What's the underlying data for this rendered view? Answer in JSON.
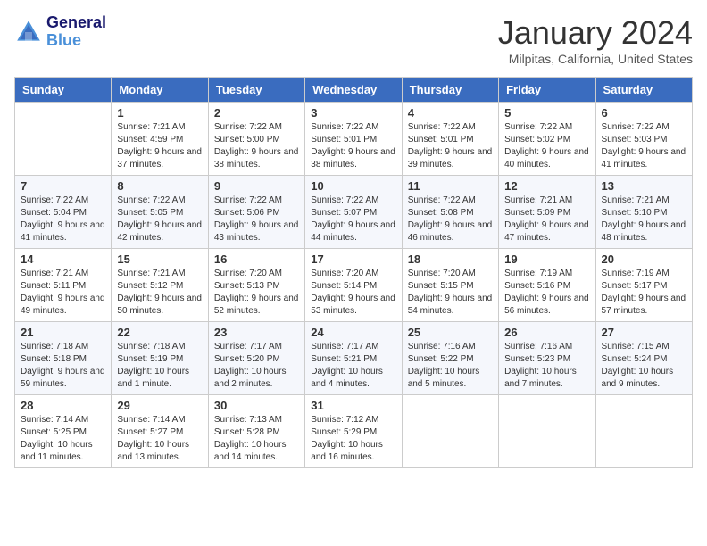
{
  "header": {
    "logo_line1": "General",
    "logo_line2": "Blue",
    "month_title": "January 2024",
    "location": "Milpitas, California, United States"
  },
  "weekdays": [
    "Sunday",
    "Monday",
    "Tuesday",
    "Wednesday",
    "Thursday",
    "Friday",
    "Saturday"
  ],
  "weeks": [
    [
      {
        "day": "",
        "sunrise": "",
        "sunset": "",
        "daylight": ""
      },
      {
        "day": "1",
        "sunrise": "Sunrise: 7:21 AM",
        "sunset": "Sunset: 4:59 PM",
        "daylight": "Daylight: 9 hours and 37 minutes."
      },
      {
        "day": "2",
        "sunrise": "Sunrise: 7:22 AM",
        "sunset": "Sunset: 5:00 PM",
        "daylight": "Daylight: 9 hours and 38 minutes."
      },
      {
        "day": "3",
        "sunrise": "Sunrise: 7:22 AM",
        "sunset": "Sunset: 5:01 PM",
        "daylight": "Daylight: 9 hours and 38 minutes."
      },
      {
        "day": "4",
        "sunrise": "Sunrise: 7:22 AM",
        "sunset": "Sunset: 5:01 PM",
        "daylight": "Daylight: 9 hours and 39 minutes."
      },
      {
        "day": "5",
        "sunrise": "Sunrise: 7:22 AM",
        "sunset": "Sunset: 5:02 PM",
        "daylight": "Daylight: 9 hours and 40 minutes."
      },
      {
        "day": "6",
        "sunrise": "Sunrise: 7:22 AM",
        "sunset": "Sunset: 5:03 PM",
        "daylight": "Daylight: 9 hours and 41 minutes."
      }
    ],
    [
      {
        "day": "7",
        "sunrise": "Sunrise: 7:22 AM",
        "sunset": "Sunset: 5:04 PM",
        "daylight": "Daylight: 9 hours and 41 minutes."
      },
      {
        "day": "8",
        "sunrise": "Sunrise: 7:22 AM",
        "sunset": "Sunset: 5:05 PM",
        "daylight": "Daylight: 9 hours and 42 minutes."
      },
      {
        "day": "9",
        "sunrise": "Sunrise: 7:22 AM",
        "sunset": "Sunset: 5:06 PM",
        "daylight": "Daylight: 9 hours and 43 minutes."
      },
      {
        "day": "10",
        "sunrise": "Sunrise: 7:22 AM",
        "sunset": "Sunset: 5:07 PM",
        "daylight": "Daylight: 9 hours and 44 minutes."
      },
      {
        "day": "11",
        "sunrise": "Sunrise: 7:22 AM",
        "sunset": "Sunset: 5:08 PM",
        "daylight": "Daylight: 9 hours and 46 minutes."
      },
      {
        "day": "12",
        "sunrise": "Sunrise: 7:21 AM",
        "sunset": "Sunset: 5:09 PM",
        "daylight": "Daylight: 9 hours and 47 minutes."
      },
      {
        "day": "13",
        "sunrise": "Sunrise: 7:21 AM",
        "sunset": "Sunset: 5:10 PM",
        "daylight": "Daylight: 9 hours and 48 minutes."
      }
    ],
    [
      {
        "day": "14",
        "sunrise": "Sunrise: 7:21 AM",
        "sunset": "Sunset: 5:11 PM",
        "daylight": "Daylight: 9 hours and 49 minutes."
      },
      {
        "day": "15",
        "sunrise": "Sunrise: 7:21 AM",
        "sunset": "Sunset: 5:12 PM",
        "daylight": "Daylight: 9 hours and 50 minutes."
      },
      {
        "day": "16",
        "sunrise": "Sunrise: 7:20 AM",
        "sunset": "Sunset: 5:13 PM",
        "daylight": "Daylight: 9 hours and 52 minutes."
      },
      {
        "day": "17",
        "sunrise": "Sunrise: 7:20 AM",
        "sunset": "Sunset: 5:14 PM",
        "daylight": "Daylight: 9 hours and 53 minutes."
      },
      {
        "day": "18",
        "sunrise": "Sunrise: 7:20 AM",
        "sunset": "Sunset: 5:15 PM",
        "daylight": "Daylight: 9 hours and 54 minutes."
      },
      {
        "day": "19",
        "sunrise": "Sunrise: 7:19 AM",
        "sunset": "Sunset: 5:16 PM",
        "daylight": "Daylight: 9 hours and 56 minutes."
      },
      {
        "day": "20",
        "sunrise": "Sunrise: 7:19 AM",
        "sunset": "Sunset: 5:17 PM",
        "daylight": "Daylight: 9 hours and 57 minutes."
      }
    ],
    [
      {
        "day": "21",
        "sunrise": "Sunrise: 7:18 AM",
        "sunset": "Sunset: 5:18 PM",
        "daylight": "Daylight: 9 hours and 59 minutes."
      },
      {
        "day": "22",
        "sunrise": "Sunrise: 7:18 AM",
        "sunset": "Sunset: 5:19 PM",
        "daylight": "Daylight: 10 hours and 1 minute."
      },
      {
        "day": "23",
        "sunrise": "Sunrise: 7:17 AM",
        "sunset": "Sunset: 5:20 PM",
        "daylight": "Daylight: 10 hours and 2 minutes."
      },
      {
        "day": "24",
        "sunrise": "Sunrise: 7:17 AM",
        "sunset": "Sunset: 5:21 PM",
        "daylight": "Daylight: 10 hours and 4 minutes."
      },
      {
        "day": "25",
        "sunrise": "Sunrise: 7:16 AM",
        "sunset": "Sunset: 5:22 PM",
        "daylight": "Daylight: 10 hours and 5 minutes."
      },
      {
        "day": "26",
        "sunrise": "Sunrise: 7:16 AM",
        "sunset": "Sunset: 5:23 PM",
        "daylight": "Daylight: 10 hours and 7 minutes."
      },
      {
        "day": "27",
        "sunrise": "Sunrise: 7:15 AM",
        "sunset": "Sunset: 5:24 PM",
        "daylight": "Daylight: 10 hours and 9 minutes."
      }
    ],
    [
      {
        "day": "28",
        "sunrise": "Sunrise: 7:14 AM",
        "sunset": "Sunset: 5:25 PM",
        "daylight": "Daylight: 10 hours and 11 minutes."
      },
      {
        "day": "29",
        "sunrise": "Sunrise: 7:14 AM",
        "sunset": "Sunset: 5:27 PM",
        "daylight": "Daylight: 10 hours and 13 minutes."
      },
      {
        "day": "30",
        "sunrise": "Sunrise: 7:13 AM",
        "sunset": "Sunset: 5:28 PM",
        "daylight": "Daylight: 10 hours and 14 minutes."
      },
      {
        "day": "31",
        "sunrise": "Sunrise: 7:12 AM",
        "sunset": "Sunset: 5:29 PM",
        "daylight": "Daylight: 10 hours and 16 minutes."
      },
      {
        "day": "",
        "sunrise": "",
        "sunset": "",
        "daylight": ""
      },
      {
        "day": "",
        "sunrise": "",
        "sunset": "",
        "daylight": ""
      },
      {
        "day": "",
        "sunrise": "",
        "sunset": "",
        "daylight": ""
      }
    ]
  ]
}
